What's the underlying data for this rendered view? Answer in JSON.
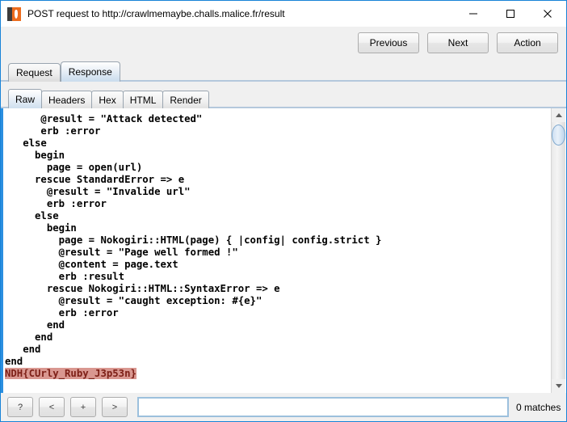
{
  "window": {
    "title": "POST request to http://crawlmemaybe.challs.malice.fr/result",
    "icon": "burp-suite-icon",
    "controls": {
      "minimize": "minimize-icon",
      "maximize": "maximize-icon",
      "close": "close-icon"
    }
  },
  "actions": {
    "previous": "Previous",
    "next": "Next",
    "action": "Action"
  },
  "outer_tabs": [
    {
      "label": "Request",
      "selected": false
    },
    {
      "label": "Response",
      "selected": true
    }
  ],
  "inner_tabs": [
    {
      "label": "Raw",
      "selected": true
    },
    {
      "label": "Headers",
      "selected": false
    },
    {
      "label": "Hex",
      "selected": false
    },
    {
      "label": "HTML",
      "selected": false
    },
    {
      "label": "Render",
      "selected": false
    }
  ],
  "code": {
    "lines": [
      "      @result = \"Attack detected\"",
      "      erb :error",
      "   else",
      "     begin",
      "       page = open(url)",
      "     rescue StandardError => e",
      "       @result = \"Invalide url\"",
      "       erb :error",
      "     else",
      "       begin",
      "         page = Nokogiri::HTML(page) { |config| config.strict }",
      "         @result = \"Page well formed !\"",
      "         @content = page.text",
      "         erb :result",
      "       rescue Nokogiri::HTML::SyntaxError => e",
      "         @result = \"caught exception: #{e}\"",
      "         erb :error",
      "       end",
      "     end",
      "   end",
      "end"
    ],
    "highlighted_line": "NDH{CUrly_Ruby_J3p53n}",
    "highlight_bg": "#d99790",
    "highlight_fg": "#7d1f16"
  },
  "scrollbar": {
    "up_arrow": "scroll-up-icon",
    "down_arrow": "scroll-down-icon"
  },
  "search": {
    "help_label": "?",
    "prev_label": "<",
    "add_label": "+",
    "next_label": ">",
    "value": "",
    "placeholder": "",
    "matches": "0 matches"
  },
  "colors": {
    "accent": "#1883d7",
    "code_border": "#2b8fe0",
    "tab_underline": "#b4c8dc"
  }
}
